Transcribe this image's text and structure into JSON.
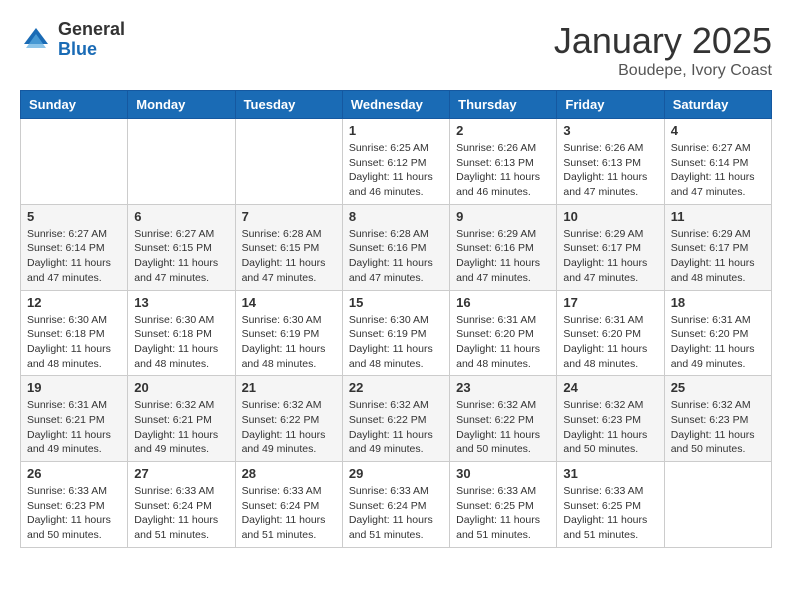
{
  "logo": {
    "general": "General",
    "blue": "Blue"
  },
  "header": {
    "month": "January 2025",
    "location": "Boudepe, Ivory Coast"
  },
  "days_of_week": [
    "Sunday",
    "Monday",
    "Tuesday",
    "Wednesday",
    "Thursday",
    "Friday",
    "Saturday"
  ],
  "weeks": [
    [
      {
        "day": "",
        "info": ""
      },
      {
        "day": "",
        "info": ""
      },
      {
        "day": "",
        "info": ""
      },
      {
        "day": "1",
        "info": "Sunrise: 6:25 AM\nSunset: 6:12 PM\nDaylight: 11 hours and 46 minutes."
      },
      {
        "day": "2",
        "info": "Sunrise: 6:26 AM\nSunset: 6:13 PM\nDaylight: 11 hours and 46 minutes."
      },
      {
        "day": "3",
        "info": "Sunrise: 6:26 AM\nSunset: 6:13 PM\nDaylight: 11 hours and 47 minutes."
      },
      {
        "day": "4",
        "info": "Sunrise: 6:27 AM\nSunset: 6:14 PM\nDaylight: 11 hours and 47 minutes."
      }
    ],
    [
      {
        "day": "5",
        "info": "Sunrise: 6:27 AM\nSunset: 6:14 PM\nDaylight: 11 hours and 47 minutes."
      },
      {
        "day": "6",
        "info": "Sunrise: 6:27 AM\nSunset: 6:15 PM\nDaylight: 11 hours and 47 minutes."
      },
      {
        "day": "7",
        "info": "Sunrise: 6:28 AM\nSunset: 6:15 PM\nDaylight: 11 hours and 47 minutes."
      },
      {
        "day": "8",
        "info": "Sunrise: 6:28 AM\nSunset: 6:16 PM\nDaylight: 11 hours and 47 minutes."
      },
      {
        "day": "9",
        "info": "Sunrise: 6:29 AM\nSunset: 6:16 PM\nDaylight: 11 hours and 47 minutes."
      },
      {
        "day": "10",
        "info": "Sunrise: 6:29 AM\nSunset: 6:17 PM\nDaylight: 11 hours and 47 minutes."
      },
      {
        "day": "11",
        "info": "Sunrise: 6:29 AM\nSunset: 6:17 PM\nDaylight: 11 hours and 48 minutes."
      }
    ],
    [
      {
        "day": "12",
        "info": "Sunrise: 6:30 AM\nSunset: 6:18 PM\nDaylight: 11 hours and 48 minutes."
      },
      {
        "day": "13",
        "info": "Sunrise: 6:30 AM\nSunset: 6:18 PM\nDaylight: 11 hours and 48 minutes."
      },
      {
        "day": "14",
        "info": "Sunrise: 6:30 AM\nSunset: 6:19 PM\nDaylight: 11 hours and 48 minutes."
      },
      {
        "day": "15",
        "info": "Sunrise: 6:30 AM\nSunset: 6:19 PM\nDaylight: 11 hours and 48 minutes."
      },
      {
        "day": "16",
        "info": "Sunrise: 6:31 AM\nSunset: 6:20 PM\nDaylight: 11 hours and 48 minutes."
      },
      {
        "day": "17",
        "info": "Sunrise: 6:31 AM\nSunset: 6:20 PM\nDaylight: 11 hours and 48 minutes."
      },
      {
        "day": "18",
        "info": "Sunrise: 6:31 AM\nSunset: 6:20 PM\nDaylight: 11 hours and 49 minutes."
      }
    ],
    [
      {
        "day": "19",
        "info": "Sunrise: 6:31 AM\nSunset: 6:21 PM\nDaylight: 11 hours and 49 minutes."
      },
      {
        "day": "20",
        "info": "Sunrise: 6:32 AM\nSunset: 6:21 PM\nDaylight: 11 hours and 49 minutes."
      },
      {
        "day": "21",
        "info": "Sunrise: 6:32 AM\nSunset: 6:22 PM\nDaylight: 11 hours and 49 minutes."
      },
      {
        "day": "22",
        "info": "Sunrise: 6:32 AM\nSunset: 6:22 PM\nDaylight: 11 hours and 49 minutes."
      },
      {
        "day": "23",
        "info": "Sunrise: 6:32 AM\nSunset: 6:22 PM\nDaylight: 11 hours and 50 minutes."
      },
      {
        "day": "24",
        "info": "Sunrise: 6:32 AM\nSunset: 6:23 PM\nDaylight: 11 hours and 50 minutes."
      },
      {
        "day": "25",
        "info": "Sunrise: 6:32 AM\nSunset: 6:23 PM\nDaylight: 11 hours and 50 minutes."
      }
    ],
    [
      {
        "day": "26",
        "info": "Sunrise: 6:33 AM\nSunset: 6:23 PM\nDaylight: 11 hours and 50 minutes."
      },
      {
        "day": "27",
        "info": "Sunrise: 6:33 AM\nSunset: 6:24 PM\nDaylight: 11 hours and 51 minutes."
      },
      {
        "day": "28",
        "info": "Sunrise: 6:33 AM\nSunset: 6:24 PM\nDaylight: 11 hours and 51 minutes."
      },
      {
        "day": "29",
        "info": "Sunrise: 6:33 AM\nSunset: 6:24 PM\nDaylight: 11 hours and 51 minutes."
      },
      {
        "day": "30",
        "info": "Sunrise: 6:33 AM\nSunset: 6:25 PM\nDaylight: 11 hours and 51 minutes."
      },
      {
        "day": "31",
        "info": "Sunrise: 6:33 AM\nSunset: 6:25 PM\nDaylight: 11 hours and 51 minutes."
      },
      {
        "day": "",
        "info": ""
      }
    ]
  ]
}
